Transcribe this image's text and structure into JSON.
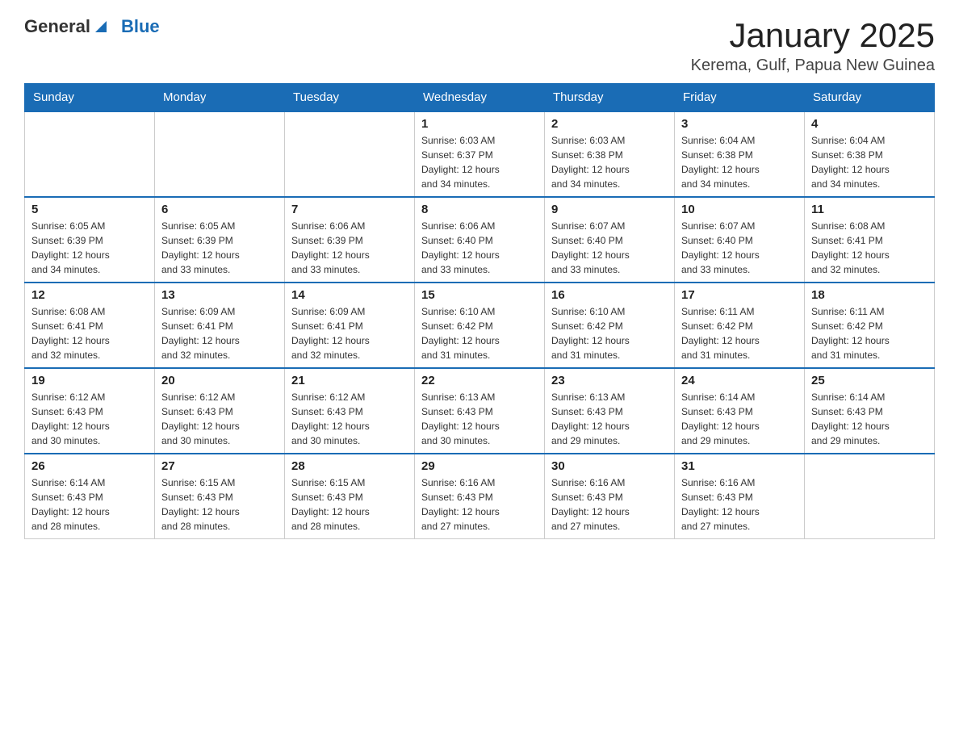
{
  "logo": {
    "text_general": "General",
    "text_blue": "Blue"
  },
  "title": "January 2025",
  "subtitle": "Kerema, Gulf, Papua New Guinea",
  "days_of_week": [
    "Sunday",
    "Monday",
    "Tuesday",
    "Wednesday",
    "Thursday",
    "Friday",
    "Saturday"
  ],
  "weeks": [
    [
      {
        "day": "",
        "info": ""
      },
      {
        "day": "",
        "info": ""
      },
      {
        "day": "",
        "info": ""
      },
      {
        "day": "1",
        "info": "Sunrise: 6:03 AM\nSunset: 6:37 PM\nDaylight: 12 hours\nand 34 minutes."
      },
      {
        "day": "2",
        "info": "Sunrise: 6:03 AM\nSunset: 6:38 PM\nDaylight: 12 hours\nand 34 minutes."
      },
      {
        "day": "3",
        "info": "Sunrise: 6:04 AM\nSunset: 6:38 PM\nDaylight: 12 hours\nand 34 minutes."
      },
      {
        "day": "4",
        "info": "Sunrise: 6:04 AM\nSunset: 6:38 PM\nDaylight: 12 hours\nand 34 minutes."
      }
    ],
    [
      {
        "day": "5",
        "info": "Sunrise: 6:05 AM\nSunset: 6:39 PM\nDaylight: 12 hours\nand 34 minutes."
      },
      {
        "day": "6",
        "info": "Sunrise: 6:05 AM\nSunset: 6:39 PM\nDaylight: 12 hours\nand 33 minutes."
      },
      {
        "day": "7",
        "info": "Sunrise: 6:06 AM\nSunset: 6:39 PM\nDaylight: 12 hours\nand 33 minutes."
      },
      {
        "day": "8",
        "info": "Sunrise: 6:06 AM\nSunset: 6:40 PM\nDaylight: 12 hours\nand 33 minutes."
      },
      {
        "day": "9",
        "info": "Sunrise: 6:07 AM\nSunset: 6:40 PM\nDaylight: 12 hours\nand 33 minutes."
      },
      {
        "day": "10",
        "info": "Sunrise: 6:07 AM\nSunset: 6:40 PM\nDaylight: 12 hours\nand 33 minutes."
      },
      {
        "day": "11",
        "info": "Sunrise: 6:08 AM\nSunset: 6:41 PM\nDaylight: 12 hours\nand 32 minutes."
      }
    ],
    [
      {
        "day": "12",
        "info": "Sunrise: 6:08 AM\nSunset: 6:41 PM\nDaylight: 12 hours\nand 32 minutes."
      },
      {
        "day": "13",
        "info": "Sunrise: 6:09 AM\nSunset: 6:41 PM\nDaylight: 12 hours\nand 32 minutes."
      },
      {
        "day": "14",
        "info": "Sunrise: 6:09 AM\nSunset: 6:41 PM\nDaylight: 12 hours\nand 32 minutes."
      },
      {
        "day": "15",
        "info": "Sunrise: 6:10 AM\nSunset: 6:42 PM\nDaylight: 12 hours\nand 31 minutes."
      },
      {
        "day": "16",
        "info": "Sunrise: 6:10 AM\nSunset: 6:42 PM\nDaylight: 12 hours\nand 31 minutes."
      },
      {
        "day": "17",
        "info": "Sunrise: 6:11 AM\nSunset: 6:42 PM\nDaylight: 12 hours\nand 31 minutes."
      },
      {
        "day": "18",
        "info": "Sunrise: 6:11 AM\nSunset: 6:42 PM\nDaylight: 12 hours\nand 31 minutes."
      }
    ],
    [
      {
        "day": "19",
        "info": "Sunrise: 6:12 AM\nSunset: 6:43 PM\nDaylight: 12 hours\nand 30 minutes."
      },
      {
        "day": "20",
        "info": "Sunrise: 6:12 AM\nSunset: 6:43 PM\nDaylight: 12 hours\nand 30 minutes."
      },
      {
        "day": "21",
        "info": "Sunrise: 6:12 AM\nSunset: 6:43 PM\nDaylight: 12 hours\nand 30 minutes."
      },
      {
        "day": "22",
        "info": "Sunrise: 6:13 AM\nSunset: 6:43 PM\nDaylight: 12 hours\nand 30 minutes."
      },
      {
        "day": "23",
        "info": "Sunrise: 6:13 AM\nSunset: 6:43 PM\nDaylight: 12 hours\nand 29 minutes."
      },
      {
        "day": "24",
        "info": "Sunrise: 6:14 AM\nSunset: 6:43 PM\nDaylight: 12 hours\nand 29 minutes."
      },
      {
        "day": "25",
        "info": "Sunrise: 6:14 AM\nSunset: 6:43 PM\nDaylight: 12 hours\nand 29 minutes."
      }
    ],
    [
      {
        "day": "26",
        "info": "Sunrise: 6:14 AM\nSunset: 6:43 PM\nDaylight: 12 hours\nand 28 minutes."
      },
      {
        "day": "27",
        "info": "Sunrise: 6:15 AM\nSunset: 6:43 PM\nDaylight: 12 hours\nand 28 minutes."
      },
      {
        "day": "28",
        "info": "Sunrise: 6:15 AM\nSunset: 6:43 PM\nDaylight: 12 hours\nand 28 minutes."
      },
      {
        "day": "29",
        "info": "Sunrise: 6:16 AM\nSunset: 6:43 PM\nDaylight: 12 hours\nand 27 minutes."
      },
      {
        "day": "30",
        "info": "Sunrise: 6:16 AM\nSunset: 6:43 PM\nDaylight: 12 hours\nand 27 minutes."
      },
      {
        "day": "31",
        "info": "Sunrise: 6:16 AM\nSunset: 6:43 PM\nDaylight: 12 hours\nand 27 minutes."
      },
      {
        "day": "",
        "info": ""
      }
    ]
  ]
}
